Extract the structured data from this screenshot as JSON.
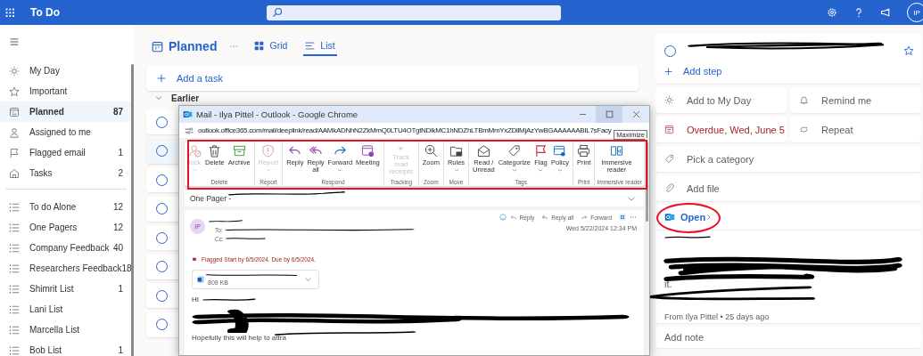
{
  "app_bar": {
    "title": "To Do",
    "avatar": "IP"
  },
  "sidebar": {
    "items": [
      {
        "label": "My Day",
        "selected": false,
        "kind": "smart"
      },
      {
        "label": "Important",
        "selected": false,
        "kind": "smart"
      },
      {
        "label": "Planned",
        "count": "87",
        "selected": true,
        "kind": "smart"
      },
      {
        "label": "Assigned to me",
        "selected": false,
        "kind": "smart"
      },
      {
        "label": "Flagged email",
        "count": "1",
        "selected": false,
        "kind": "smart"
      },
      {
        "label": "Tasks",
        "count": "2",
        "selected": false,
        "kind": "smart"
      },
      {
        "label": "To do Alone",
        "count": "12",
        "selected": false,
        "kind": "list"
      },
      {
        "label": "One Pagers",
        "count": "12",
        "selected": false,
        "kind": "list"
      },
      {
        "label": "Company Feedback",
        "count": "40",
        "selected": false,
        "kind": "list"
      },
      {
        "label": "Researchers Feedback",
        "count": "18",
        "selected": false,
        "kind": "list"
      },
      {
        "label": "Shimrit List",
        "count": "1",
        "selected": false,
        "kind": "list"
      },
      {
        "label": "Lani List",
        "selected": false,
        "kind": "list"
      },
      {
        "label": "Marcella List",
        "selected": false,
        "kind": "list"
      },
      {
        "label": "Bob List",
        "count": "1",
        "selected": false,
        "kind": "list"
      }
    ]
  },
  "list_header": {
    "title": "Planned",
    "views": [
      {
        "label": "Grid",
        "selected": false
      },
      {
        "label": "List",
        "selected": true
      }
    ]
  },
  "add_task": {
    "placeholder": "Add a task"
  },
  "group": {
    "label": "Earlier"
  },
  "tasks": [
    {
      "selected": false
    },
    {
      "selected": true
    },
    {
      "selected": false
    },
    {
      "selected": false
    },
    {
      "selected": false
    },
    {
      "selected": false
    },
    {
      "selected": false
    },
    {
      "selected": false
    }
  ],
  "mail_window": {
    "title": "Mail - Ilya Pittel - Outlook - Google Chrome",
    "url": "outlook.office365.com/mail/deeplink/read/AAMkADNhN2ZkMmQ0LTU4OTgtNDlkMC1hNDZhLTBmMmYxZDllMjAzYwBGAAAAAABIL7sFacy",
    "tooltip": "Maximize",
    "ribbon": [
      {
        "label": "Delete",
        "buttons": [
          {
            "label": "lock",
            "disabled": true,
            "dropdown": true
          },
          {
            "label": "Delete",
            "disabled": false,
            "dropdown": false
          },
          {
            "label": "Archive",
            "disabled": false,
            "dropdown": false
          }
        ]
      },
      {
        "label": "Report",
        "buttons": [
          {
            "label": "Report",
            "disabled": true,
            "dropdown": true
          }
        ]
      },
      {
        "label": "Respond",
        "buttons": [
          {
            "label": "Reply",
            "disabled": false,
            "dropdown": false
          },
          {
            "label": "Reply all",
            "disabled": false,
            "dropdown": false
          },
          {
            "label": "Forward",
            "disabled": false,
            "dropdown": true
          },
          {
            "label": "Meeting",
            "disabled": false,
            "dropdown": false
          }
        ]
      },
      {
        "label": "Tracking",
        "buttons": [
          {
            "label": "Track read receipts",
            "disabled": true,
            "dropdown": false
          }
        ]
      },
      {
        "label": "Zoom",
        "buttons": [
          {
            "label": "Zoom",
            "disabled": false,
            "dropdown": false
          }
        ]
      },
      {
        "label": "Move",
        "buttons": [
          {
            "label": "Rules",
            "disabled": false,
            "dropdown": true
          }
        ]
      },
      {
        "label": "Tags",
        "buttons": [
          {
            "label": "Read / Unread",
            "disabled": false,
            "dropdown": false
          },
          {
            "label": "Categorize",
            "disabled": false,
            "dropdown": true
          },
          {
            "label": "Flag",
            "disabled": false,
            "dropdown": true
          },
          {
            "label": "Policy",
            "disabled": false,
            "dropdown": true
          }
        ]
      },
      {
        "label": "Print",
        "buttons": [
          {
            "label": "Print",
            "disabled": false,
            "dropdown": false
          }
        ]
      },
      {
        "label": "Immersive reader",
        "buttons": [
          {
            "label": "Immersive reader",
            "disabled": false,
            "dropdown": false
          }
        ]
      }
    ],
    "subject": "One Pager -",
    "message": {
      "avatar": "IP",
      "to_label": "To:",
      "cc_label": "Cc:",
      "actions": [
        "Reply",
        "Reply all",
        "Forward"
      ],
      "date": "Wed 5/22/2024 12:34 PM",
      "flag": "Flagged Start by 6/5/2024. Due by 6/5/2024.",
      "attachment": {
        "size": "809 KB"
      },
      "greeting": "HI",
      "closing": "Hopefully this will help to attra"
    }
  },
  "detail": {
    "completed": false,
    "add_step": "Add step",
    "options": [
      {
        "label": "Add to My Day"
      },
      {
        "label": "Remind me"
      },
      {
        "label": "Overdue, Wed, June 5",
        "overdue": true
      },
      {
        "label": "Repeat"
      },
      {
        "label": "Pick a category"
      },
      {
        "label": "Add file"
      }
    ],
    "email": {
      "open": "Open",
      "tail": "it.",
      "from": "From Ilya Pittel • 25 days ago"
    },
    "note": {
      "placeholder": "Add note"
    }
  }
}
